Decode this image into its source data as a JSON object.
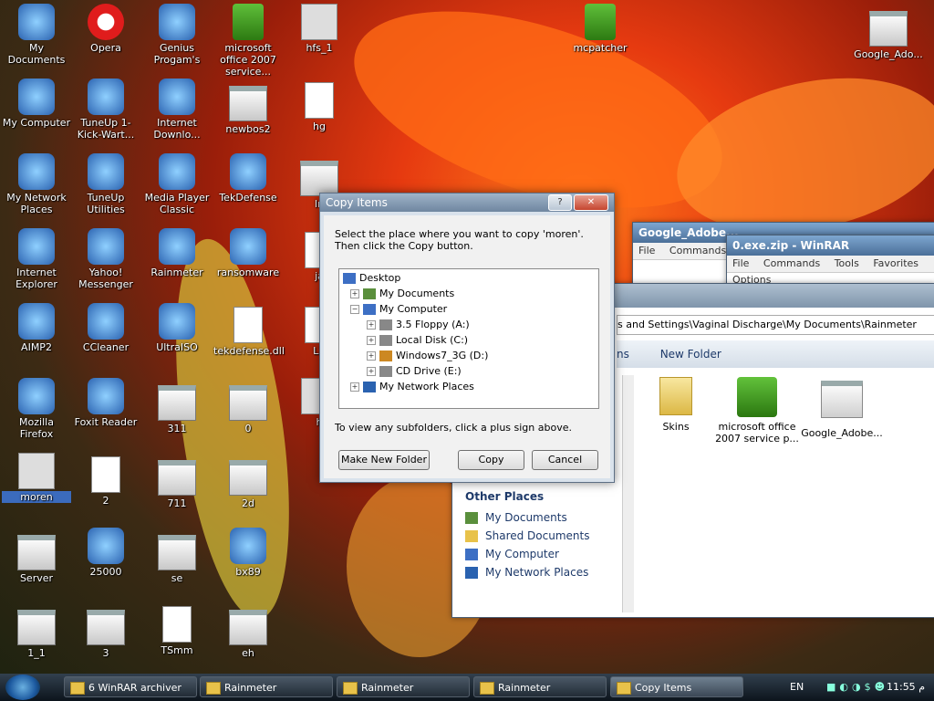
{
  "desktop": {
    "icons": [
      {
        "label": "My Documents",
        "icon": "my-documents-icon"
      },
      {
        "label": "Opera",
        "icon": "opera-icon"
      },
      {
        "label": "Genius Progam's",
        "icon": "genius-icon"
      },
      {
        "label": "microsoft office 2007 service...",
        "icon": "zip-icon"
      },
      {
        "label": "hfs_1",
        "icon": "speaker-icon"
      },
      {
        "label": "mcpatcher",
        "icon": "zip-icon"
      },
      {
        "label": "Google_Ado...",
        "icon": "folder-icon"
      },
      {
        "label": "My Computer",
        "icon": "my-computer-icon"
      },
      {
        "label": "TuneUp 1-Kick-Wart...",
        "icon": "tuneup-icon"
      },
      {
        "label": "Internet Downlo...",
        "icon": "idm-icon"
      },
      {
        "label": "newbos2",
        "icon": "folder-icon"
      },
      {
        "label": "hg",
        "icon": "document-icon"
      },
      {
        "label": "My Network Places",
        "icon": "network-icon"
      },
      {
        "label": "TuneUp Utilities",
        "icon": "tuneup-icon"
      },
      {
        "label": "Media Player Classic",
        "icon": "mpc-icon"
      },
      {
        "label": "TekDefense",
        "icon": "tekdefense-icon"
      },
      {
        "label": "In",
        "icon": "folder-icon"
      },
      {
        "label": "Internet Explorer",
        "icon": "ie-icon"
      },
      {
        "label": "Yahoo! Messenger",
        "icon": "yahoo-icon"
      },
      {
        "label": "Rainmeter",
        "icon": "rainmeter-icon"
      },
      {
        "label": "ransomware",
        "icon": "winrar-icon"
      },
      {
        "label": "ja",
        "icon": "document-icon"
      },
      {
        "label": "AIMP2",
        "icon": "aimp-icon"
      },
      {
        "label": "CCleaner",
        "icon": "ccleaner-icon"
      },
      {
        "label": "UltraISO",
        "icon": "disc-icon"
      },
      {
        "label": "tekdefense.dll",
        "icon": "dll-icon"
      },
      {
        "label": "LX",
        "icon": "document-icon"
      },
      {
        "label": "Mozilla Firefox",
        "icon": "firefox-icon"
      },
      {
        "label": "Foxit Reader",
        "icon": "foxit-icon"
      },
      {
        "label": "311",
        "icon": "folder-icon"
      },
      {
        "label": "0",
        "icon": "folder-icon"
      },
      {
        "label": "h",
        "icon": "speaker-icon"
      },
      {
        "label": "moren",
        "icon": "speaker-icon"
      },
      {
        "label": "2",
        "icon": "document-icon"
      },
      {
        "label": "711",
        "icon": "folder-icon"
      },
      {
        "label": "2d",
        "icon": "folder-icon"
      },
      {
        "label": "Server",
        "icon": "folder-icon"
      },
      {
        "label": "25000",
        "icon": "google-plus-icon"
      },
      {
        "label": "se",
        "icon": "folder-icon"
      },
      {
        "label": "bx89",
        "icon": "blob-icon"
      },
      {
        "label": "1_1",
        "icon": "folder-icon"
      },
      {
        "label": "3",
        "icon": "folder-icon"
      },
      {
        "label": "TSmm",
        "icon": "document-icon"
      },
      {
        "label": "eh",
        "icon": "folder-icon"
      }
    ]
  },
  "winrar1": {
    "title": "Google_Adobe...",
    "menu": [
      "File",
      "Commands"
    ]
  },
  "winrar2": {
    "title": "0.exe.zip - WinRAR",
    "menu": [
      "File",
      "Commands",
      "Tools",
      "Favorites",
      "Options"
    ]
  },
  "explorer": {
    "address": "s and Settings\\Vaginal Discharge\\My Documents\\Rainmeter",
    "toolbar": {
      "tasks_label": "ns",
      "new_folder_label": "New Folder"
    },
    "items": [
      {
        "label": "Skins"
      },
      {
        "label": "microsoft office 2007 service p..."
      },
      {
        "label": "Google_Adobe..."
      }
    ],
    "other_places": {
      "heading": "Other Places",
      "links": [
        "My Documents",
        "Shared Documents",
        "My Computer",
        "My Network Places"
      ]
    }
  },
  "dialog": {
    "title": "Copy Items",
    "help_label": "?",
    "close_label": "✕",
    "message": "Select the place where you want to copy 'moren'. Then click the Copy button.",
    "tree": {
      "root": "Desktop",
      "nodes": [
        {
          "label": "My Documents",
          "expander": "+"
        },
        {
          "label": "My Computer",
          "expander": "−"
        },
        {
          "label": "3.5 Floppy (A:)",
          "expander": "+"
        },
        {
          "label": "Local Disk (C:)",
          "expander": "+"
        },
        {
          "label": "Windows7_3G (D:)",
          "expander": "+"
        },
        {
          "label": "CD Drive (E:)",
          "expander": "+"
        },
        {
          "label": "My Network Places",
          "expander": "+"
        }
      ]
    },
    "hint": "To view any subfolders, click a plus sign above.",
    "buttons": {
      "new_folder": "Make New Folder",
      "copy": "Copy",
      "cancel": "Cancel"
    }
  },
  "taskbar": {
    "buttons": [
      {
        "label": "6 WinRAR archiver"
      },
      {
        "label": "Rainmeter"
      },
      {
        "label": "Rainmeter"
      },
      {
        "label": "Rainmeter"
      },
      {
        "label": "Copy Items"
      }
    ],
    "language": "EN",
    "clock": "11:55 م"
  }
}
